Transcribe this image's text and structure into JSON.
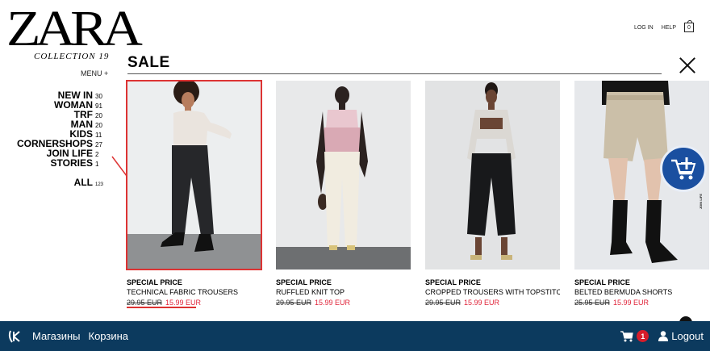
{
  "brand": {
    "logo_text": "ZARA",
    "collection": "COLLECTION 19",
    "menu_label": "MENU +"
  },
  "top_links": {
    "login": "LOG IN",
    "help": "HELP",
    "bag_count": "0"
  },
  "sale": {
    "title": "SALE"
  },
  "categories": [
    {
      "name": "NEW IN",
      "count": "30"
    },
    {
      "name": "WOMAN",
      "count": "91"
    },
    {
      "name": "TRF",
      "count": "20"
    },
    {
      "name": "MAN",
      "count": "20"
    },
    {
      "name": "KIDS",
      "count": "11"
    },
    {
      "name": "CORNERSHOPS",
      "count": "27"
    },
    {
      "name": "JOIN LIFE",
      "count": "2"
    },
    {
      "name": "STORIES",
      "count": "1"
    },
    {
      "name": "ALL",
      "count": "123"
    }
  ],
  "products": [
    {
      "tag": "SPECIAL PRICE",
      "name": "TECHNICAL FABRIC TROUSERS",
      "old_price": "29.95 EUR",
      "new_price": "15.99 EUR"
    },
    {
      "tag": "SPECIAL PRICE",
      "name": "RUFFLED KNIT TOP",
      "old_price": "29.95 EUR",
      "new_price": "15.99 EUR"
    },
    {
      "tag": "SPECIAL PRICE",
      "name": "CROPPED TROUSERS WITH TOPSTITCH...",
      "old_price": "29.95 EUR",
      "new_price": "15.99 EUR"
    },
    {
      "tag": "SPECIAL PRICE",
      "name": "BELTED BERMUDA SHORTS",
      "old_price": "25.95 EUR",
      "new_price": "15.99 EUR"
    }
  ],
  "side_note": "JOIN LIFE",
  "bottom_bar": {
    "stores": "Магазины",
    "cart": "Корзина",
    "cart_count": "1",
    "logout": "Logout"
  },
  "colors": {
    "accent_red": "#e0243a",
    "bar_blue": "#0c3a5e",
    "fab_blue": "#1a4fa0"
  }
}
